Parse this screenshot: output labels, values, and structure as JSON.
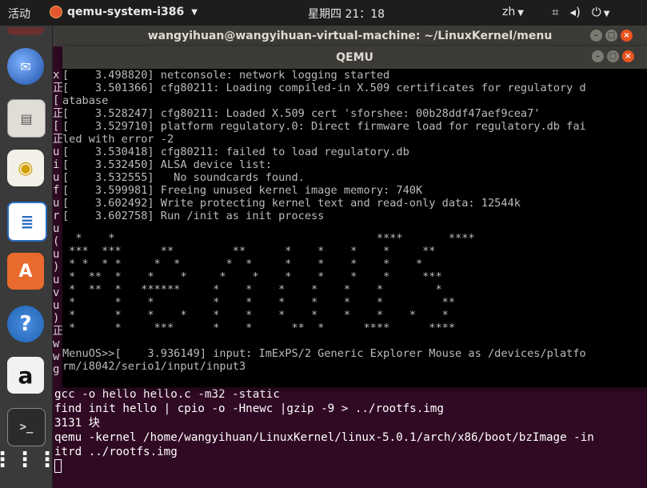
{
  "topbar": {
    "activities": "活动",
    "app_name": "qemu-system-i386",
    "clock": "星期四 21：18",
    "lang": "zh",
    "icons": [
      "network-icon",
      "volume-icon",
      "power-icon"
    ]
  },
  "dock": {
    "items": [
      "thunderbird-icon",
      "files-icon",
      "rhythmbox-icon",
      "writer-icon",
      "software-center-icon",
      "help-icon",
      "amazon-icon",
      "terminal-icon",
      "app-grid-icon"
    ]
  },
  "terminal": {
    "title": "wangyihuan@wangyihuan-virtual-machine: ~/LinuxKernel/menu",
    "left_fragments": [
      "x",
      "正",
      "[",
      "正",
      "[",
      "正",
      "u",
      "i",
      "u",
      "f",
      "u",
      "r",
      "u",
      "(",
      "u",
      ")",
      "u",
      "v",
      "u",
      ")",
      "正",
      "w",
      "w",
      "g"
    ],
    "lines": [
      "gcc -o hello hello.c -m32 -static",
      "find init hello | cpio -o -Hnewc |gzip -9 > ../rootfs.img",
      "3131 块",
      "qemu -kernel /home/wangyihuan/LinuxKernel/linux-5.0.1/arch/x86/boot/bzImage -in",
      "itrd ../rootfs.img"
    ]
  },
  "qemu": {
    "title": "QEMU",
    "log": [
      "[    3.498820] netconsole: network logging started",
      "[    3.501366] cfg80211: Loading compiled-in X.509 certificates for regulatory d",
      "atabase",
      "[    3.528247] cfg80211: Loaded X.509 cert 'sforshee: 00b28ddf47aef9cea7'",
      "[    3.529710] platform regulatory.0: Direct firmware load for regulatory.db fai",
      "led with error -2",
      "[    3.530418] cfg80211: failed to load regulatory.db",
      "[    3.532450] ALSA device list:",
      "[    3.532555]   No soundcards found.",
      "[    3.599981] Freeing unused kernel image memory: 740K",
      "[    3.602492] Write protecting kernel text and read-only data: 12544k",
      "[    3.602758] Run /init as init process"
    ],
    "banner": [
      "  *    *                                        ****       ****",
      " ***  ***      **         **      *    *    *    *     **",
      " * *  * *     *  *       *  *     *    *    *    *    *",
      " *  **  *    *    *     *    *    *    *    *    *     ***",
      " *  **  *   ******     *    *    *    *    *    *        *",
      " *      *    *         *    *    *    *    *    *         **",
      " *      *    *    *    *    *    *    *    *    *    *    *",
      " *      *     ***      *    *      **  *      ****      ****"
    ],
    "prompt_lines": [
      "MenuOS>>[    3.936149] input: ImExPS/2 Generic Explorer Mouse as /devices/platfo",
      "rm/i8042/serio1/input/input3"
    ]
  }
}
